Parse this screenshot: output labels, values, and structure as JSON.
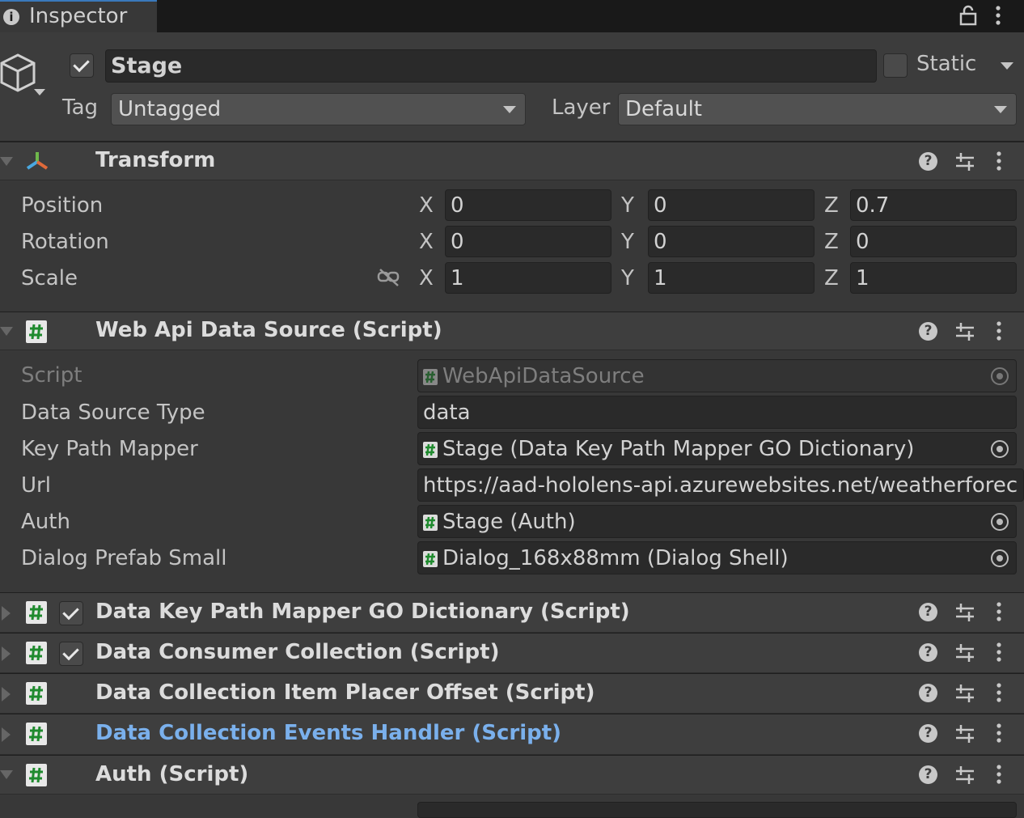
{
  "tab": {
    "title": "Inspector"
  },
  "object": {
    "active": true,
    "name": "Stage",
    "static_label": "Static",
    "static": false,
    "tag_label": "Tag",
    "tag_value": "Untagged",
    "layer_label": "Layer",
    "layer_value": "Default"
  },
  "transform": {
    "title": "Transform",
    "rows": [
      {
        "label": "Position",
        "x": "0",
        "y": "0",
        "z": "0.7"
      },
      {
        "label": "Rotation",
        "x": "0",
        "y": "0",
        "z": "0"
      },
      {
        "label": "Scale",
        "x": "1",
        "y": "1",
        "z": "1"
      }
    ],
    "axis": {
      "x": "X",
      "y": "Y",
      "z": "Z"
    }
  },
  "webapi": {
    "title": "Web Api Data Source (Script)",
    "script_label": "Script",
    "script_value": "WebApiDataSource",
    "dst_label": "Data Source Type",
    "dst_value": "data",
    "kpm_label": "Key Path Mapper",
    "kpm_value": "Stage (Data Key Path Mapper GO Dictionary)",
    "url_label": "Url",
    "url_value": "https://aad-hololens-api.azurewebsites.net/weatherforec",
    "auth_label": "Auth",
    "auth_value": "Stage (Auth)",
    "dps_label": "Dialog Prefab Small",
    "dps_value": "Dialog_168x88mm (Dialog Shell)"
  },
  "components": [
    {
      "title": "Data Key Path Mapper GO Dictionary (Script)",
      "enabled": true
    },
    {
      "title": "Data Consumer Collection (Script)",
      "enabled": true
    },
    {
      "title": "Data Collection Item Placer Offset (Script)"
    },
    {
      "title": "Data Collection Events Handler (Script)",
      "color": "#7ab0ec"
    },
    {
      "title": "Auth (Script)"
    }
  ],
  "colors": {
    "accent": "#3a79bb",
    "link": "#7ab0ec",
    "hash_icon": "#1f8a2e"
  }
}
